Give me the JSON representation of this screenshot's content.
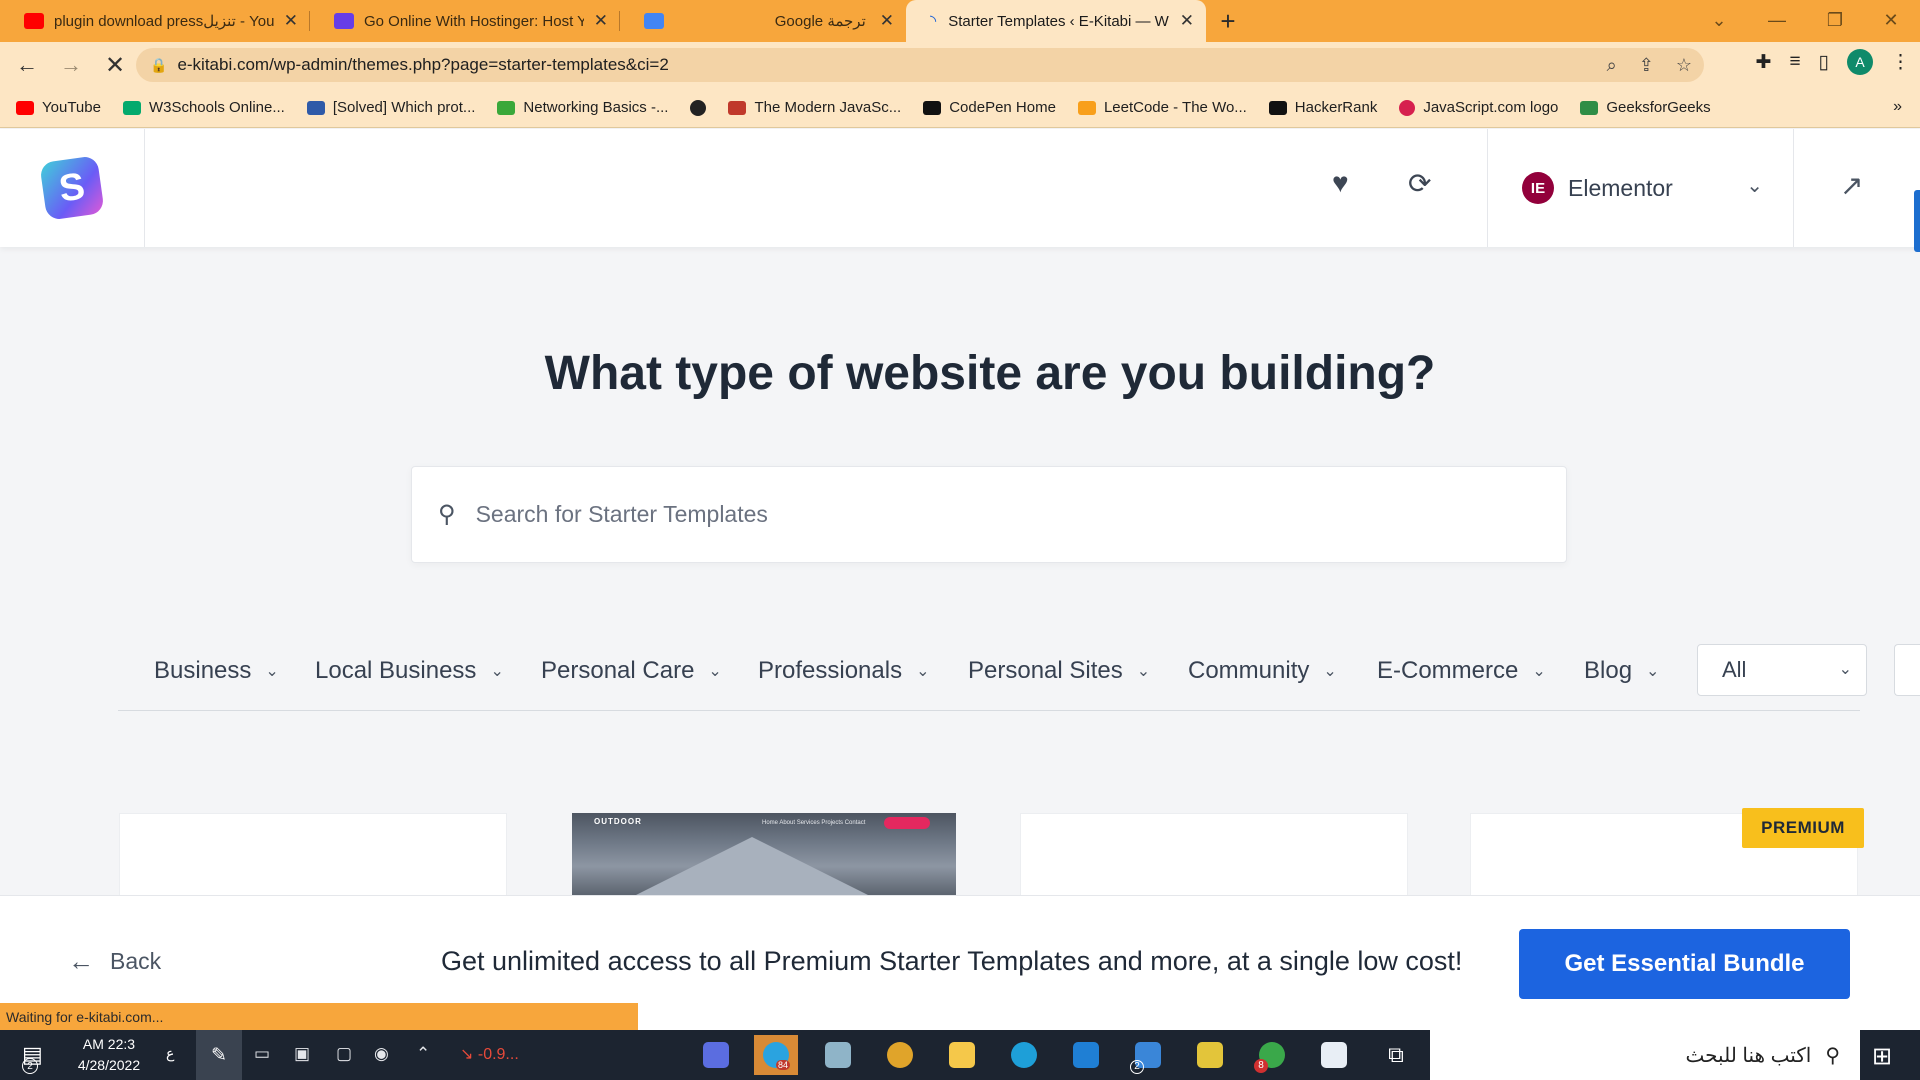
{
  "browser": {
    "tabs": [
      {
        "title": "plugin download pressتنزيل - You",
        "favicon_color": "#ff0000",
        "active": false
      },
      {
        "title": "Go Online With Hostinger: Host Y",
        "favicon_color": "#673de6",
        "active": false
      },
      {
        "title": "Google ترجمة",
        "favicon_color": "#4285f4",
        "active": false
      },
      {
        "title": "Starter Templates ‹ E-Kitabi — W",
        "favicon_color": "#1e63d6",
        "active": true
      }
    ],
    "new_tab": "+",
    "window": {
      "minimize": "—",
      "restore": "❐",
      "close": "✕",
      "dropdown": "⌄"
    },
    "url": "e-kitabi.com/wp-admin/themes.php?page=starter-templates&ci=2",
    "bookmarks": [
      {
        "label": "YouTube",
        "color": "#ff0000"
      },
      {
        "label": "W3Schools Online...",
        "color": "#04aa6d"
      },
      {
        "label": "[Solved] Which prot...",
        "color": "#2f5aa8"
      },
      {
        "label": "Networking Basics -...",
        "color": "#3aa83a"
      },
      {
        "label": "",
        "color": "#222222"
      },
      {
        "label": "The Modern JavaSc...",
        "color": "#c0392b"
      },
      {
        "label": "CodePen Home",
        "color": "#111111"
      },
      {
        "label": "LeetCode - The Wo...",
        "color": "#f89f1b"
      },
      {
        "label": "HackerRank",
        "color": "#111111"
      },
      {
        "label": "JavaScript.com logo",
        "color": "#d6204e"
      },
      {
        "label": "GeeksforGeeks",
        "color": "#2f8d46"
      }
    ],
    "bookmarks_more": "»",
    "avatar": "A",
    "status": "Waiting for e-kitabi.com..."
  },
  "app": {
    "logo_letter": "S",
    "builder": {
      "badge": "IE",
      "label": "Elementor"
    },
    "title": "What type of website are you building?",
    "search_placeholder": "Search for Starter Templates",
    "categories": [
      "Business",
      "Local Business",
      "Personal Care",
      "Professionals",
      "Personal Sites",
      "Community",
      "E-Commerce",
      "Blog"
    ],
    "filter_select": "All",
    "premium_badge": "PREMIUM",
    "thumb": {
      "logo": "OUTDOOR",
      "nav": "Home   About   Services   Projects   Contact"
    },
    "back_label": "Back",
    "promo": "Get unlimited access to all Premium Starter Templates and more, at a single low cost!",
    "cta": "Get Essential Bundle"
  },
  "taskbar": {
    "time": "AM 22:3",
    "date": "4/28/2022",
    "lang": "ع",
    "stock": "-0.9...",
    "notify_count": "2",
    "telegram_badge": "84",
    "mail_badge": "2",
    "chrome_badge": "8",
    "search_placeholder": "اكتب هنا للبحث"
  }
}
